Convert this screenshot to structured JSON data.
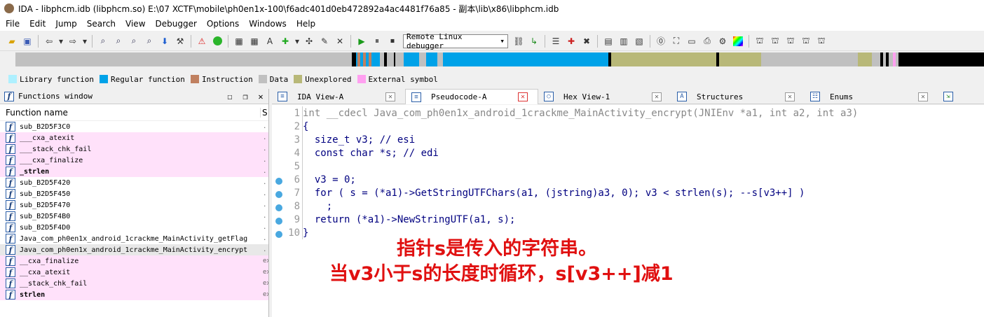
{
  "window": {
    "title": "IDA - libphcm.idb (libphcm.so) E:\\07 XCTF\\mobile\\ph0en1x-100\\f6adc401d0eb472892a4ac4481f76a85 - 副本\\lib\\x86\\libphcm.idb"
  },
  "menu": {
    "items": [
      "File",
      "Edit",
      "Jump",
      "Search",
      "View",
      "Debugger",
      "Options",
      "Windows",
      "Help"
    ]
  },
  "toolbar": {
    "debugger_select": "Remote Linux debugger"
  },
  "legend": {
    "items": [
      {
        "label": "Library function",
        "color": "#aef0ff"
      },
      {
        "label": "Regular function",
        "color": "#00a2e8"
      },
      {
        "label": "Instruction",
        "color": "#c08060"
      },
      {
        "label": "Data",
        "color": "#c0c0c0"
      },
      {
        "label": "Unexplored",
        "color": "#b8b878"
      },
      {
        "label": "External symbol",
        "color": "#ffa0f0"
      }
    ]
  },
  "functions_window": {
    "title": "Functions window",
    "col_name": "Function name",
    "col_segment": "S",
    "rows": [
      {
        "name": "sub_B2D5F3C0",
        "seg": "."
      },
      {
        "name": "___cxa_atexit",
        "seg": "."
      },
      {
        "name": "___stack_chk_fail",
        "seg": "."
      },
      {
        "name": "___cxa_finalize",
        "seg": "."
      },
      {
        "name": "_strlen",
        "seg": "."
      },
      {
        "name": "sub_B2D5F420",
        "seg": "."
      },
      {
        "name": "sub_B2D5F450",
        "seg": "."
      },
      {
        "name": "sub_B2D5F470",
        "seg": "."
      },
      {
        "name": "sub_B2D5F4B0",
        "seg": "."
      },
      {
        "name": "sub_B2D5F4D0",
        "seg": "."
      },
      {
        "name": "Java_com_ph0en1x_android_1crackme_MainActivity_getFlag",
        "seg": "."
      },
      {
        "name": "Java_com_ph0en1x_android_1crackme_MainActivity_encrypt",
        "seg": "."
      },
      {
        "name": "__cxa_finalize",
        "seg": "ex"
      },
      {
        "name": "__cxa_atexit",
        "seg": "ex"
      },
      {
        "name": "__stack_chk_fail",
        "seg": "ex"
      },
      {
        "name": "strlen",
        "seg": "ex"
      }
    ]
  },
  "tabs": [
    {
      "label": "IDA View-A"
    },
    {
      "label": "Pseudocode-A"
    },
    {
      "label": "Hex View-1"
    },
    {
      "label": "Structures"
    },
    {
      "label": "Enums"
    }
  ],
  "code": {
    "lines": [
      {
        "n": "1",
        "text": "int __cdecl Java_com_ph0en1x_android_1crackme_MainActivity_encrypt(JNIEnv *a1, int a2, int a3)"
      },
      {
        "n": "2",
        "text": "{"
      },
      {
        "n": "3",
        "text": "  size_t v3; // esi"
      },
      {
        "n": "4",
        "text": "  const char *s; // edi"
      },
      {
        "n": "5",
        "text": ""
      },
      {
        "n": "6",
        "text": "  v3 = 0;"
      },
      {
        "n": "7",
        "text": "  for ( s = (*a1)->GetStringUTFChars(a1, (jstring)a3, 0); v3 < strlen(s); --s[v3++] )"
      },
      {
        "n": "8",
        "text": "    ;"
      },
      {
        "n": "9",
        "text": "  return (*a1)->NewStringUTF(a1, s);"
      },
      {
        "n": "10",
        "text": "}"
      }
    ]
  },
  "annotation": {
    "line1": "指针s是传入的字符串。",
    "line2": "当v3小于s的长度时循环，s[v3++]减1"
  }
}
